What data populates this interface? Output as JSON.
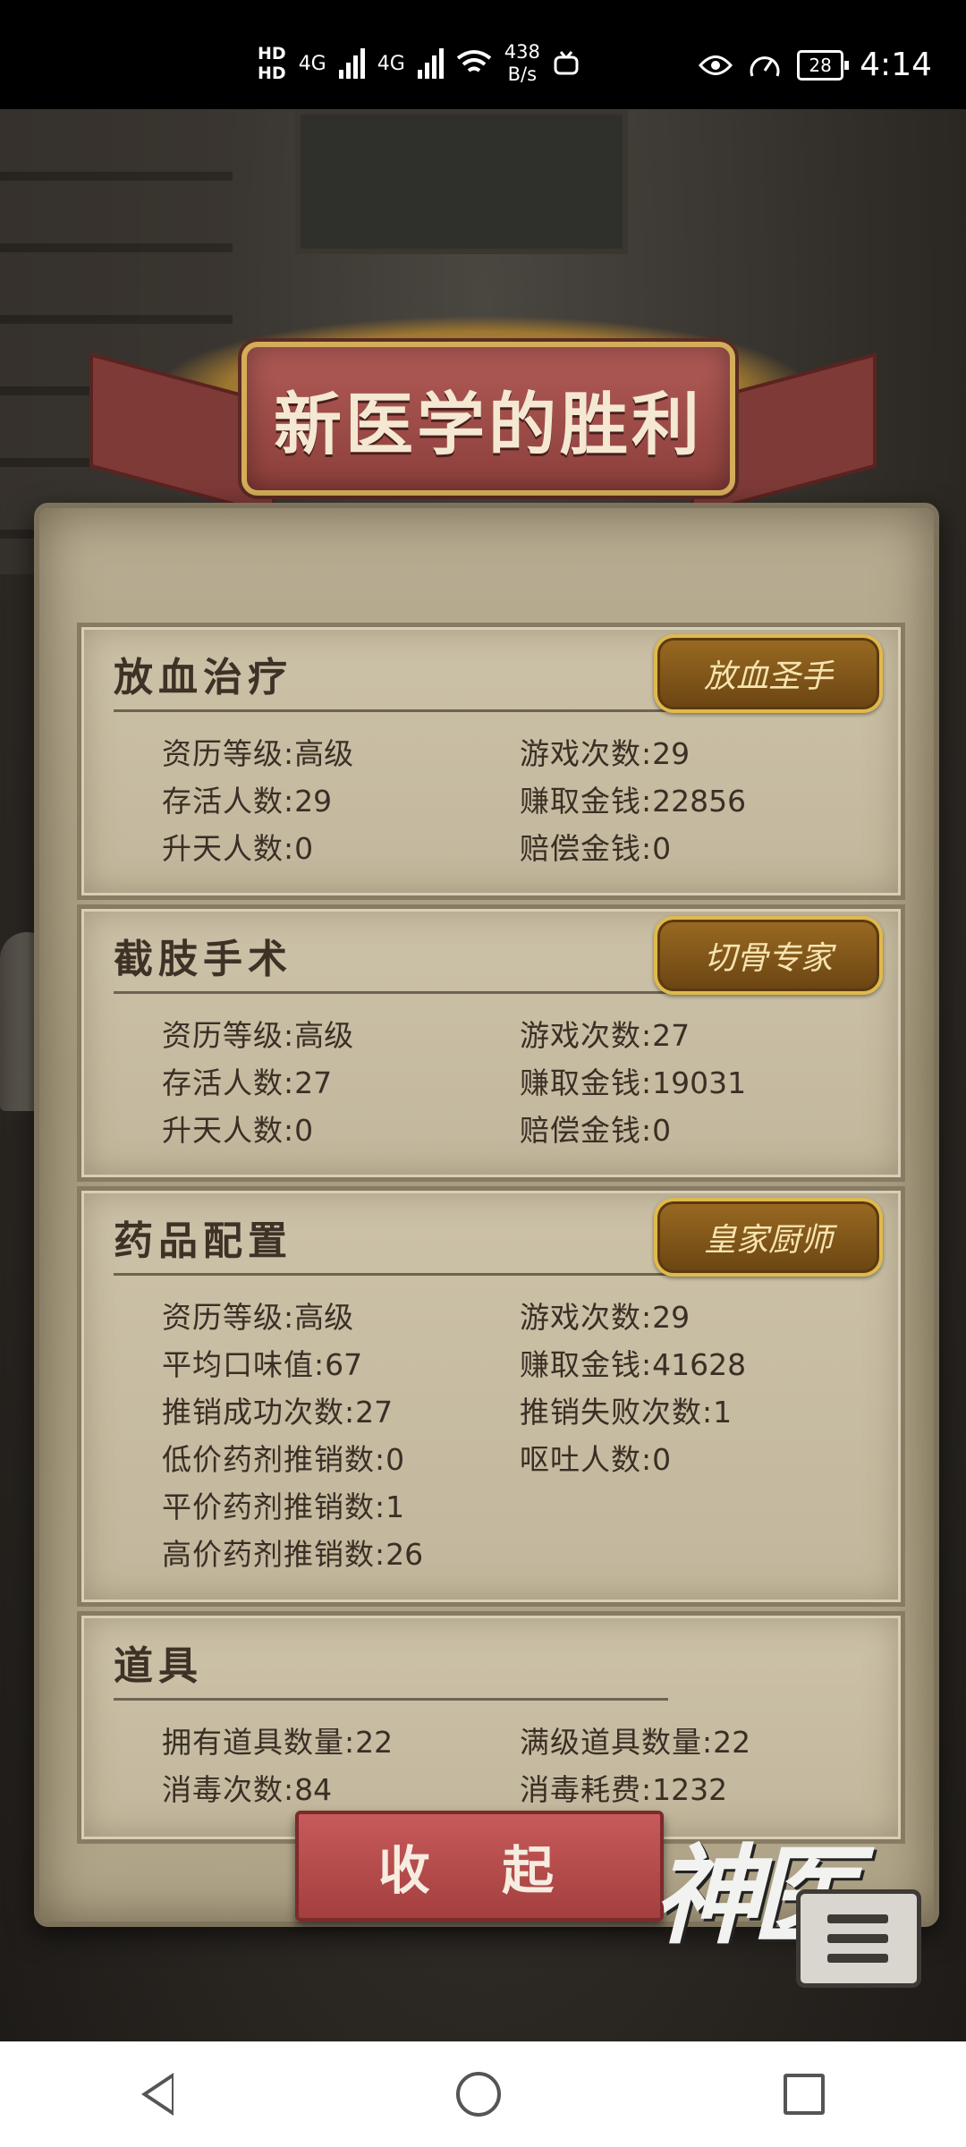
{
  "status_bar": {
    "hd1": "HD",
    "hd2": "HD",
    "net1": "4G",
    "net2": "4G",
    "speed_value": "438",
    "speed_unit": "B/s",
    "battery": "28",
    "time": "4:14"
  },
  "title": "新医学的胜利",
  "sections": [
    {
      "title": "放血治疗",
      "badge": "放血圣手",
      "stats": [
        {
          "label": "资历等级:",
          "value": "高级"
        },
        {
          "label": "游戏次数:",
          "value": "29"
        },
        {
          "label": "存活人数:",
          "value": "29"
        },
        {
          "label": "赚取金钱:",
          "value": "22856"
        },
        {
          "label": "升天人数:",
          "value": "0"
        },
        {
          "label": "赔偿金钱:",
          "value": "0"
        }
      ]
    },
    {
      "title": "截肢手术",
      "badge": "切骨专家",
      "stats": [
        {
          "label": "资历等级:",
          "value": "高级"
        },
        {
          "label": "游戏次数:",
          "value": "27"
        },
        {
          "label": "存活人数:",
          "value": "27"
        },
        {
          "label": "赚取金钱:",
          "value": "19031"
        },
        {
          "label": "升天人数:",
          "value": "0"
        },
        {
          "label": "赔偿金钱:",
          "value": "0"
        }
      ]
    },
    {
      "title": "药品配置",
      "badge": "皇家厨师",
      "stats": [
        {
          "label": "资历等级:",
          "value": "高级"
        },
        {
          "label": "游戏次数:",
          "value": "29"
        },
        {
          "label": "平均口味值:",
          "value": "67"
        },
        {
          "label": "赚取金钱:",
          "value": "41628"
        },
        {
          "label": "推销成功次数:",
          "value": "27"
        },
        {
          "label": "推销失败次数:",
          "value": "1"
        },
        {
          "label": "低价药剂推销数:",
          "value": "0"
        },
        {
          "label": "呕吐人数:",
          "value": "0"
        },
        {
          "label": "平价药剂推销数:",
          "value": "1"
        },
        {
          "label": "高价药剂推销数:",
          "value": "26"
        }
      ]
    },
    {
      "title": "道具",
      "stats": [
        {
          "label": "拥有道具数量:",
          "value": "22"
        },
        {
          "label": "满级道具数量:",
          "value": "22"
        },
        {
          "label": "消毒次数:",
          "value": "84"
        },
        {
          "label": "消毒耗费:",
          "value": "1232"
        }
      ]
    }
  ],
  "collapse_button": "收 起",
  "logo_text": "神医",
  "icons": {
    "eye": "eye-icon",
    "gauge": "gauge-icon",
    "wifi": "wifi-icon",
    "menu": "menu-list-icon",
    "nav_back": "back-icon",
    "nav_home": "home-icon",
    "nav_recent": "recent-apps-icon"
  }
}
